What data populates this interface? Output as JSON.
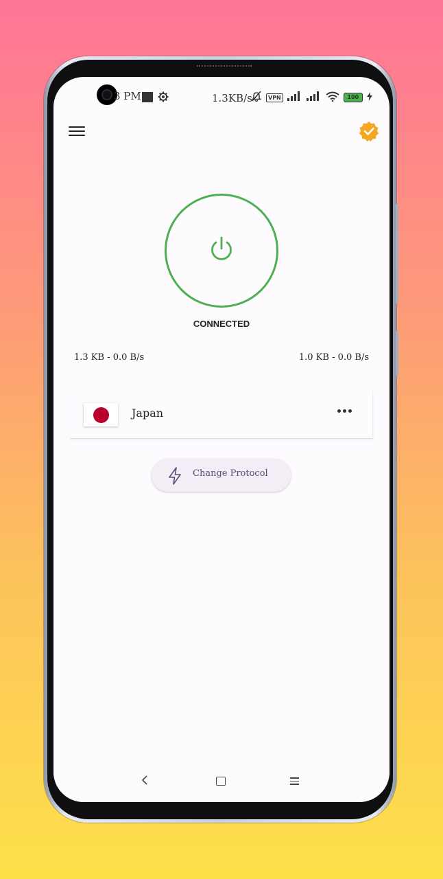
{
  "status_bar": {
    "time": "3 PM",
    "net_speed": "1.3KB/s",
    "vpn_badge": "VPN",
    "battery_level": "100",
    "icons": [
      "camera-notch-icon",
      "notification-square-icon",
      "settings-gear-icon",
      "mute-bell-icon",
      "vpn-icon",
      "signal-icon",
      "signal-icon",
      "wifi-icon",
      "battery-icon",
      "charging-bolt-icon"
    ]
  },
  "app_bar": {
    "menu_icon": "hamburger-menu-icon",
    "badge_icon": "verified-badge-icon",
    "badge_color": "#f5a623"
  },
  "connection": {
    "power_icon": "power-icon",
    "ring_color": "#4caf50",
    "status": "CONNECTED",
    "download": "1.3 KB - 0.0 B/s",
    "upload": "1.0 KB - 0.0 B/s"
  },
  "server": {
    "flag_icon": "japan-flag-icon",
    "name": "Japan",
    "more_icon": "more-horizontal-icon"
  },
  "protocol_button": {
    "icon": "lightning-icon",
    "label": "Change Protocol"
  },
  "nav_bar": {
    "back_icon": "back-chevron-icon",
    "home_icon": "home-square-icon",
    "recents_icon": "recents-menu-icon"
  }
}
